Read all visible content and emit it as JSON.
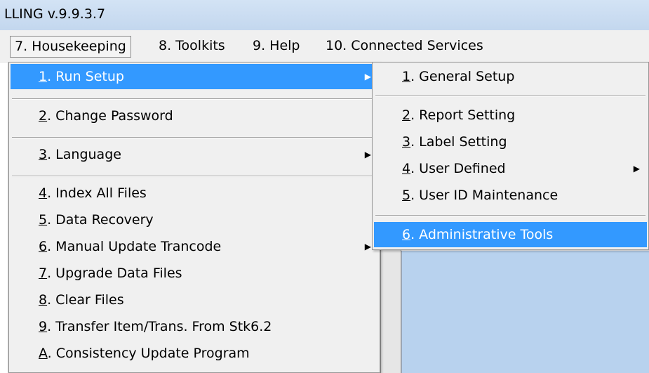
{
  "window": {
    "title": "LLING v.9.9.3.7"
  },
  "menubar": {
    "items": [
      {
        "label": "7. Housekeeping"
      },
      {
        "label": "8. Toolkits"
      },
      {
        "label": "9. Help"
      },
      {
        "label": "10. Connected Services"
      }
    ]
  },
  "housekeeping_menu": {
    "items": [
      {
        "key": "1",
        "label": ". Run Setup",
        "submenu": true
      },
      {
        "key": "2",
        "label": ". Change Password"
      },
      {
        "key": "3",
        "label": ". Language",
        "submenu": true
      },
      {
        "key": "4",
        "label": ". Index All Files"
      },
      {
        "key": "5",
        "label": ". Data Recovery"
      },
      {
        "key": "6",
        "label": ". Manual Update Trancode",
        "submenu": true
      },
      {
        "key": "7",
        "label": ". Upgrade Data Files"
      },
      {
        "key": "8",
        "label": ". Clear Files"
      },
      {
        "key": "9",
        "label": ". Transfer Item/Trans. From Stk6.2"
      },
      {
        "key": "A",
        "label": ". Consistency Update Program"
      }
    ]
  },
  "run_setup_menu": {
    "items": [
      {
        "key": "1",
        "label": ". General Setup"
      },
      {
        "key": "2",
        "label": ". Report Setting"
      },
      {
        "key": "3",
        "label": ". Label Setting"
      },
      {
        "key": "4",
        "label": ". User Defined",
        "submenu": true
      },
      {
        "key": "5",
        "label": ". User ID Maintenance"
      },
      {
        "key": "6",
        "label": ". Administrative Tools"
      }
    ]
  },
  "icons": {
    "submenu_arrow": "triangle-right-icon"
  },
  "colors": {
    "highlight": "#3399ff",
    "titlebar": "#c9dcf2",
    "panel": "#b8d2ee"
  }
}
